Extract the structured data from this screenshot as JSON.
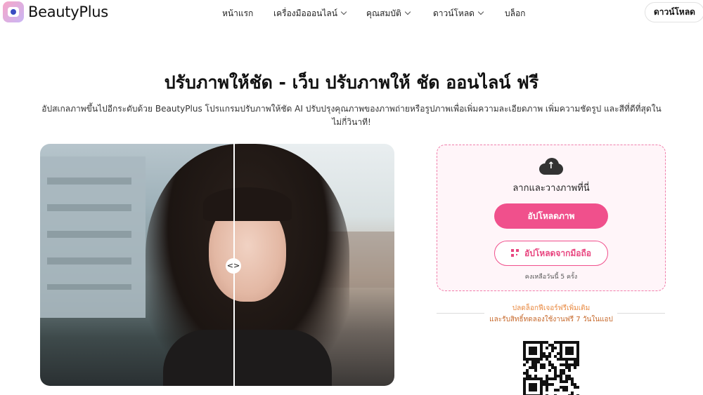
{
  "header": {
    "brand": "BeautyPlus",
    "nav": [
      {
        "label": "หน้าแรก",
        "dropdown": false
      },
      {
        "label": "เครื่องมือออนไลน์",
        "dropdown": true
      },
      {
        "label": "คุณสมบัติ",
        "dropdown": true
      },
      {
        "label": "ดาวน์โหลด",
        "dropdown": true
      },
      {
        "label": "บล็อก",
        "dropdown": false
      }
    ],
    "download_button": "ดาวน์โหลด"
  },
  "hero": {
    "title": "ปรับภาพให้ชัด - เว็บ ปรับภาพให้ ชัด ออนไลน์ ฟรี",
    "subtitle": "อัปสเกลภาพขึ้นไปอีกระดับด้วย BeautyPlus โปรแกรมปรับภาพให้ชัด AI ปรับปรุงคุณภาพของภาพถ่ายหรือรูปภาพเพื่อเพิ่มความละเอียดภาพ เพิ่มความชัดรูป และสีที่ดีที่สุดในไม่กี่วินาที!"
  },
  "compare": {
    "handle_icon": "<>",
    "slider_position": 0.54
  },
  "upload": {
    "icon": "cloud-upload-icon",
    "drag_text": "ลากและวางภาพที่นี่",
    "upload_button": "อัปโหลดภาพ",
    "mobile_button": "อัปโหลดจากมือถือ",
    "remaining": "คงเหลือวันนี้ 5  ครั้ง"
  },
  "promo": {
    "line1": "ปลดล็อกฟีเจอร์ฟรีเพิ่มเติม",
    "line2": "และรับสิทธิ์ทดลองใช้งานฟรี 7 วันในแอป"
  },
  "colors": {
    "accent": "#f0508c",
    "card_border": "#f07eab",
    "card_bg": "#fff5f9",
    "promo_text": "#e98a42"
  }
}
